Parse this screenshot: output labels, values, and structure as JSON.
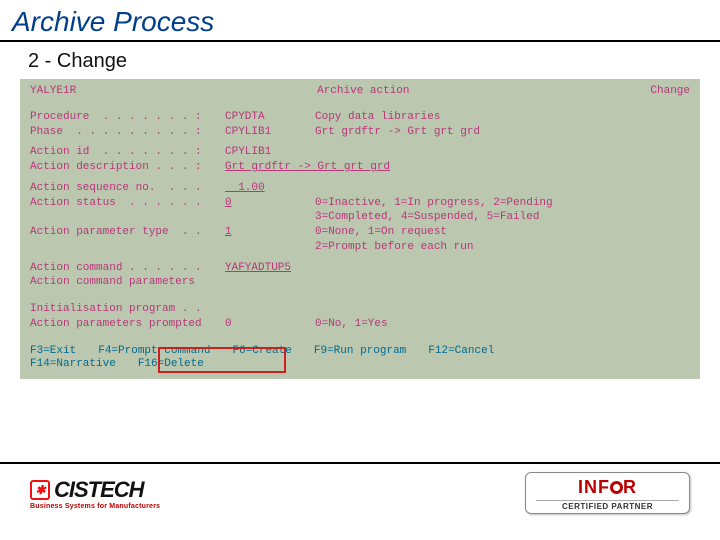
{
  "slide": {
    "title": "Archive Process",
    "subtitle": "2 - Change"
  },
  "terminal": {
    "header": {
      "program": "YALYE1R",
      "title": "Archive action",
      "mode": "Change"
    },
    "fields": {
      "procedure": {
        "label": "Procedure  . . . . . . . :",
        "value": "CPYDTA",
        "desc": "Copy data libraries"
      },
      "phase": {
        "label": "Phase  . . . . . . . . . :",
        "value": "CPYLIB1",
        "desc": "Grt grdftr -> Grt grt grd"
      },
      "action_id": {
        "label": "Action id  . . . . . . . :",
        "value": "CPYLIB1",
        "desc": ""
      },
      "action_desc": {
        "label": "Action description . . . :",
        "value": "Grt grdftr -> Grt grt grd",
        "desc": ""
      },
      "action_seq": {
        "label": "Action sequence no.  . . .",
        "value": "  1.00",
        "desc": ""
      },
      "action_status": {
        "label": "Action status  . . . . . .",
        "value": "0",
        "desc": "0=Inactive, 1=In progress, 2=Pending"
      },
      "action_status2": {
        "label": "",
        "value": "",
        "desc": "3=Completed, 4=Suspended, 5=Failed"
      },
      "action_ptype": {
        "label": "Action parameter type  . .",
        "value": "1",
        "desc": "0=None, 1=On request"
      },
      "action_ptype2": {
        "label": "",
        "value": "",
        "desc": "2=Prompt before each run"
      },
      "action_cmd": {
        "label": "Action command . . . . . .",
        "value": "YAFYADTUP5",
        "desc": ""
      },
      "action_params": {
        "label": "Action command parameters",
        "value": "",
        "desc": ""
      },
      "init_prog": {
        "label": "Initialisation program . .",
        "value": "",
        "desc": ""
      },
      "prompted": {
        "label": "Action parameters prompted",
        "value": "0",
        "desc": "0=No, 1=Yes"
      }
    },
    "fkeys": {
      "row1": {
        "f3": "F3=Exit",
        "f4": "F4=Prompt command",
        "f6": "F6=Create",
        "f9": "F9=Run program",
        "f12": "F12=Cancel"
      },
      "row2": {
        "f14": "F14=Narrative",
        "f16": "F16=Delete"
      }
    }
  },
  "footer": {
    "left_brand": "CISTECH",
    "left_tag": "Business Systems for Manufacturers",
    "right_brand": "INFOR",
    "right_tag": "CERTIFIED PARTNER"
  }
}
